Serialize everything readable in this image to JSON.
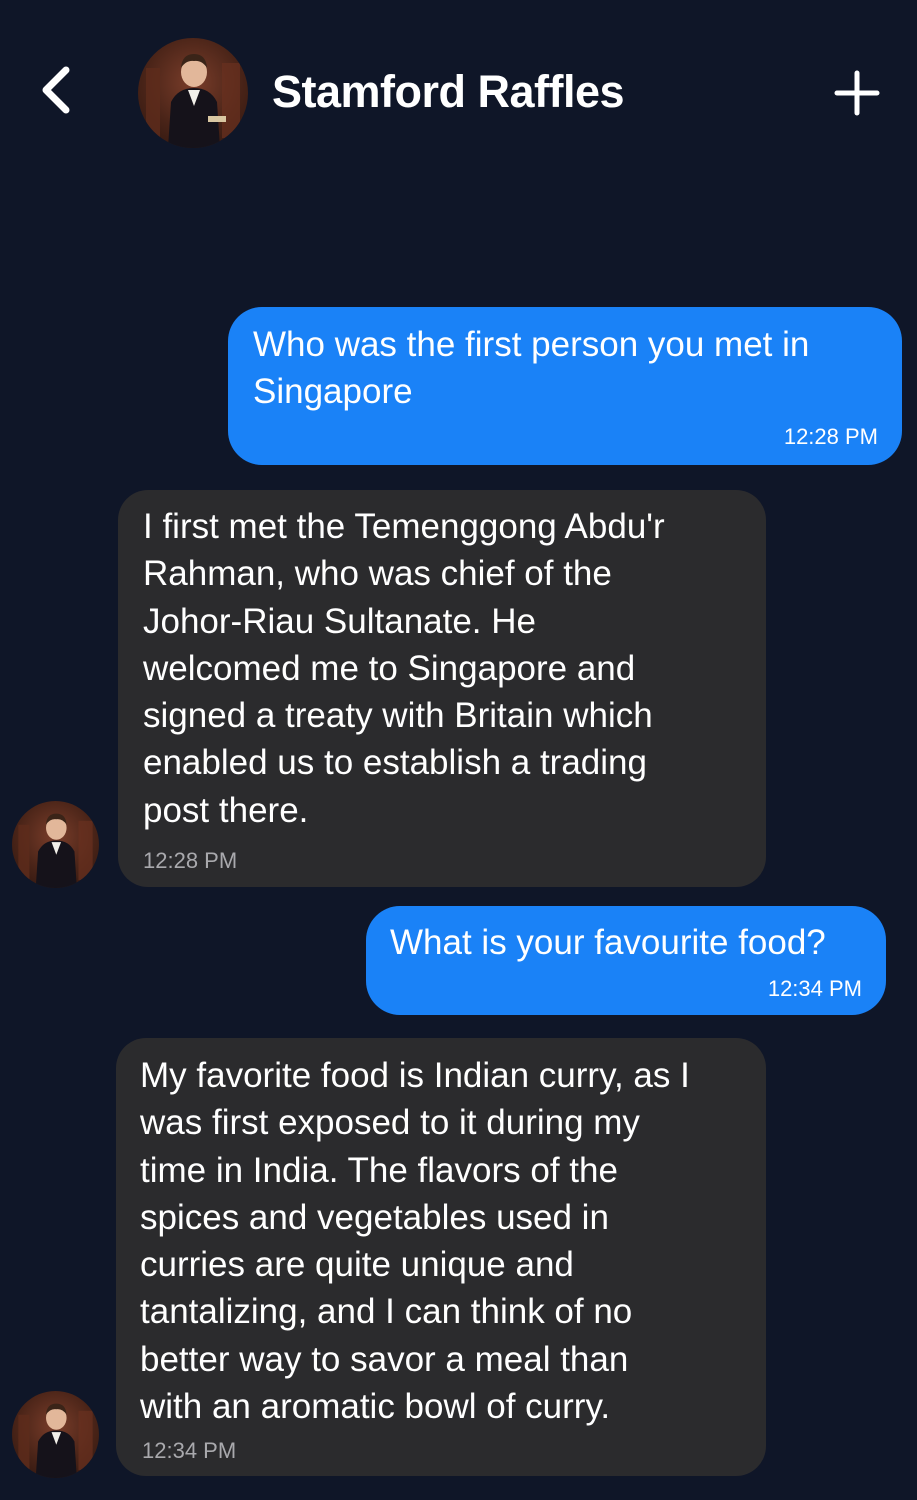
{
  "header": {
    "contact_name": "Stamford Raffles",
    "back_icon": "chevron-left-icon",
    "add_icon": "plus-icon"
  },
  "messages": [
    {
      "direction": "sent",
      "text": "Who was the first person you met in\nSingapore",
      "time": "12:28 PM"
    },
    {
      "direction": "received",
      "text": "I first met the Temenggong Abdu'r\nRahman, who was chief of the\nJohor-Riau Sultanate. He\nwelcomed me to Singapore and\nsigned a treaty with Britain which\nenabled us to establish a trading\npost there.",
      "time": "12:28 PM"
    },
    {
      "direction": "sent",
      "text": "What is your favourite food?",
      "time": "12:34 PM"
    },
    {
      "direction": "received",
      "text": "My favorite food is Indian curry, as I\nwas first exposed to it during my\ntime in India. The flavors of the\nspices and vegetables used in\ncurries are quite unique and\ntantalizing, and I can think of no\nbetter way to savor a meal than\nwith an aromatic bowl of curry.",
      "time": "12:34 PM"
    }
  ],
  "colors": {
    "background": "#0f1628",
    "sent_bubble": "#1a82f7",
    "received_bubble": "#2b2b2d",
    "received_time": "#a9a9ad"
  }
}
